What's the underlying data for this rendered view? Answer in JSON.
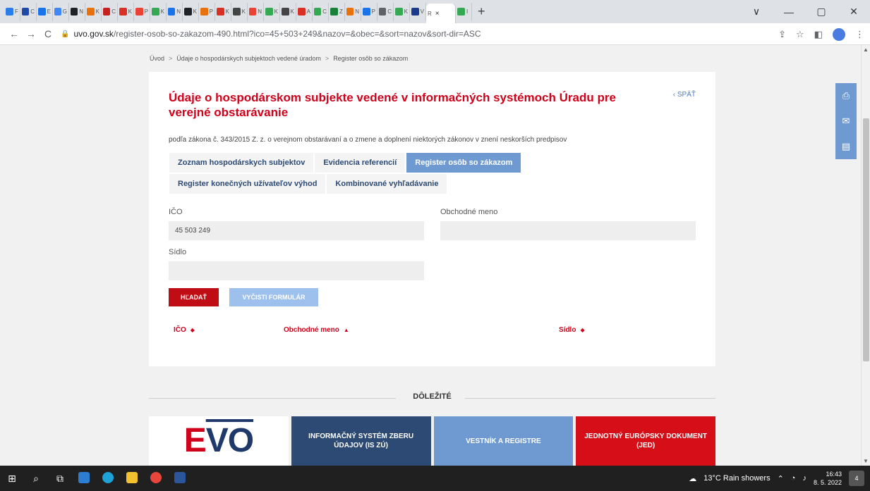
{
  "browser": {
    "tabs": [
      {
        "icon": "github-icon",
        "label": "F",
        "color": "#2b7de9"
      },
      {
        "icon": "doc-icon",
        "label": "C",
        "color": "#1f4aa8"
      },
      {
        "icon": "image-icon",
        "label": "E",
        "color": "#1a73e8"
      },
      {
        "icon": "google-icon",
        "label": "G",
        "color": "#4285f4"
      },
      {
        "icon": "google-icon",
        "label": "N",
        "color": "#202124"
      },
      {
        "icon": "puzzle-icon",
        "label": "K",
        "color": "#e8710a"
      },
      {
        "icon": "square-icon",
        "label": "C",
        "color": "#c5221f"
      },
      {
        "icon": "square-icon",
        "label": "K",
        "color": "#d93025"
      },
      {
        "icon": "search-icon",
        "label": "P",
        "color": "#ea4335"
      },
      {
        "icon": "grid-icon",
        "label": "K",
        "color": "#34a853"
      },
      {
        "icon": "loop-icon",
        "label": "N",
        "color": "#1a73e8"
      },
      {
        "icon": "google-icon",
        "label": "K",
        "color": "#202124"
      },
      {
        "icon": "puzzle-icon",
        "label": "P",
        "color": "#e8710a"
      },
      {
        "icon": "chart-icon",
        "label": "K",
        "color": "#d93025"
      },
      {
        "icon": "cat-icon",
        "label": "K",
        "color": "#444444"
      },
      {
        "icon": "search-icon",
        "label": "N",
        "color": "#ea4335"
      },
      {
        "icon": "grid-icon",
        "label": "K",
        "color": "#34a853"
      },
      {
        "icon": "cat-icon",
        "label": "K",
        "color": "#444444"
      },
      {
        "icon": "globe-icon",
        "label": "A",
        "color": "#d93025"
      },
      {
        "icon": "grid-icon",
        "label": "C",
        "color": "#34a853"
      },
      {
        "icon": "sheet-icon",
        "label": "Z",
        "color": "#188038"
      },
      {
        "icon": "firefox-icon",
        "label": "N",
        "color": "#e8710a"
      },
      {
        "icon": "image-icon",
        "label": "P",
        "color": "#1a73e8"
      },
      {
        "icon": "sheet-icon",
        "label": "C",
        "color": "#5f6368"
      },
      {
        "icon": "grid-icon",
        "label": "K",
        "color": "#34a853"
      },
      {
        "icon": "flag-icon",
        "label": "V",
        "color": "#1a3a8c"
      }
    ],
    "active_tab": {
      "label": "R",
      "close": "×"
    },
    "extra_tab": {
      "label": "I"
    },
    "new_tab": "+",
    "window_controls": [
      "∨",
      "—",
      "▢",
      "✕"
    ],
    "nav": {
      "back": "←",
      "forward": "→",
      "reload": "C"
    },
    "url": {
      "host": "uvo.gov.sk",
      "path": "/register-osob-so-zakazom-490.html?ico=45+503+249&nazov=&obec=&sort=nazov&sort-dir=ASC"
    },
    "addr_icons": [
      "⇪",
      "☆",
      "◧",
      "⋮"
    ]
  },
  "breadcrumb": {
    "items": [
      "Úvod",
      "Údaje o hospodárskych subjektoch vedené úradom",
      "Register osôb so zákazom"
    ],
    "separator": ">"
  },
  "page": {
    "title": "Údaje o hospodárskom subjekte vedené v informačných systémoch Úradu pre verejné obstarávanie",
    "back_label": "‹ SPÄŤ",
    "subtitle": "podľa zákona č. 343/2015 Z. z. o verejnom obstarávaní a o zmene a doplnení niektorých zákonov v znení neskorších predpisov",
    "tabs_row1": [
      "Zoznam hospodárskych subjektov",
      "Evidencia referencií",
      "Register osôb so zákazom"
    ],
    "tabs_row2": [
      "Register konečných užívateľov výhod",
      "Kombinované vyhľadávanie"
    ],
    "active_tab": "Register osôb so zákazom"
  },
  "form": {
    "ico_label": "IČO",
    "ico_value": "45 503 249",
    "name_label": "Obchodné meno",
    "name_value": "",
    "seat_label": "Sídlo",
    "seat_value": "",
    "search_button": "HĽADAŤ",
    "clear_button": "VYČISTI FORMULÁR"
  },
  "table": {
    "columns": [
      {
        "label": "IČO",
        "sort": "◆"
      },
      {
        "label": "Obchodné meno",
        "sort": "▲"
      },
      {
        "label": "Sídlo",
        "sort": "◆"
      }
    ]
  },
  "important": {
    "heading": "DÔLEŽITÉ"
  },
  "banners": {
    "evo_e": "E",
    "evo_vo": "VO",
    "iszu": "INFORMAČNÝ SYSTÉM ZBERU ÚDAJOV (IS ZÚ)",
    "vestnik": "VESTNÍK A REGISTRE",
    "jed": "JEDNOTNÝ EURÓPSKY DOKUMENT (JED)"
  },
  "sidetools": [
    "print-icon",
    "mail-icon",
    "pdf-icon"
  ],
  "taskbar": {
    "weather": "13°C Rain showers",
    "time": "16:43",
    "date": "8. 5. 2022",
    "notifications": "4"
  },
  "colors": {
    "accent_red": "#d0021b",
    "active_tab_blue": "#6f9ad1",
    "dark_blue": "#2c4a73",
    "search_red": "#c00d15"
  }
}
